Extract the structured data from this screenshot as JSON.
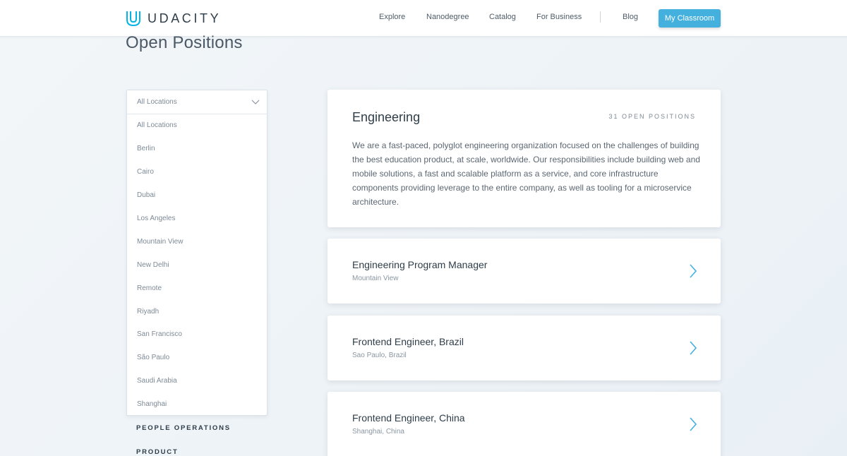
{
  "header": {
    "logo_text": "UDACITY",
    "nav": [
      "Explore",
      "Nanodegree",
      "Catalog",
      "For Business",
      "Blog"
    ],
    "cta_label": "My Classroom",
    "accent_color": "#44b0de"
  },
  "page": {
    "title": "Open Positions"
  },
  "location_filter": {
    "selected": "All Locations",
    "options": [
      "All Locations",
      "Berlin",
      "Cairo",
      "Dubai",
      "Los Angeles",
      "Mountain View",
      "New Delhi",
      "Remote",
      "Riyadh",
      "San Francisco",
      "São Paulo",
      "Saudi Arabia",
      "Shanghai"
    ]
  },
  "categories": [
    "PEOPLE OPERATIONS",
    "PRODUCT"
  ],
  "department": {
    "title": "Engineering",
    "count_label": "31 OPEN POSITIONS",
    "description": "We are a fast-paced, polyglot engineering organization focused on the challenges of building the best education product, at scale, worldwide. Our responsibilities include building web and mobile solutions, a fast and scalable platform as a service, and core infrastructure components providing leverage to the entire company, as well as tooling for a microservice architecture."
  },
  "jobs": [
    {
      "title": "Engineering Program Manager",
      "location": "Mountain View",
      "icon": "chevron-right-icon"
    },
    {
      "title": "Frontend Engineer, Brazil",
      "location": "Sao Paulo, Brazil",
      "icon": "chevron-right-icon"
    },
    {
      "title": "Frontend Engineer, China",
      "location": "Shanghai, China",
      "icon": "chevron-right-icon"
    }
  ]
}
